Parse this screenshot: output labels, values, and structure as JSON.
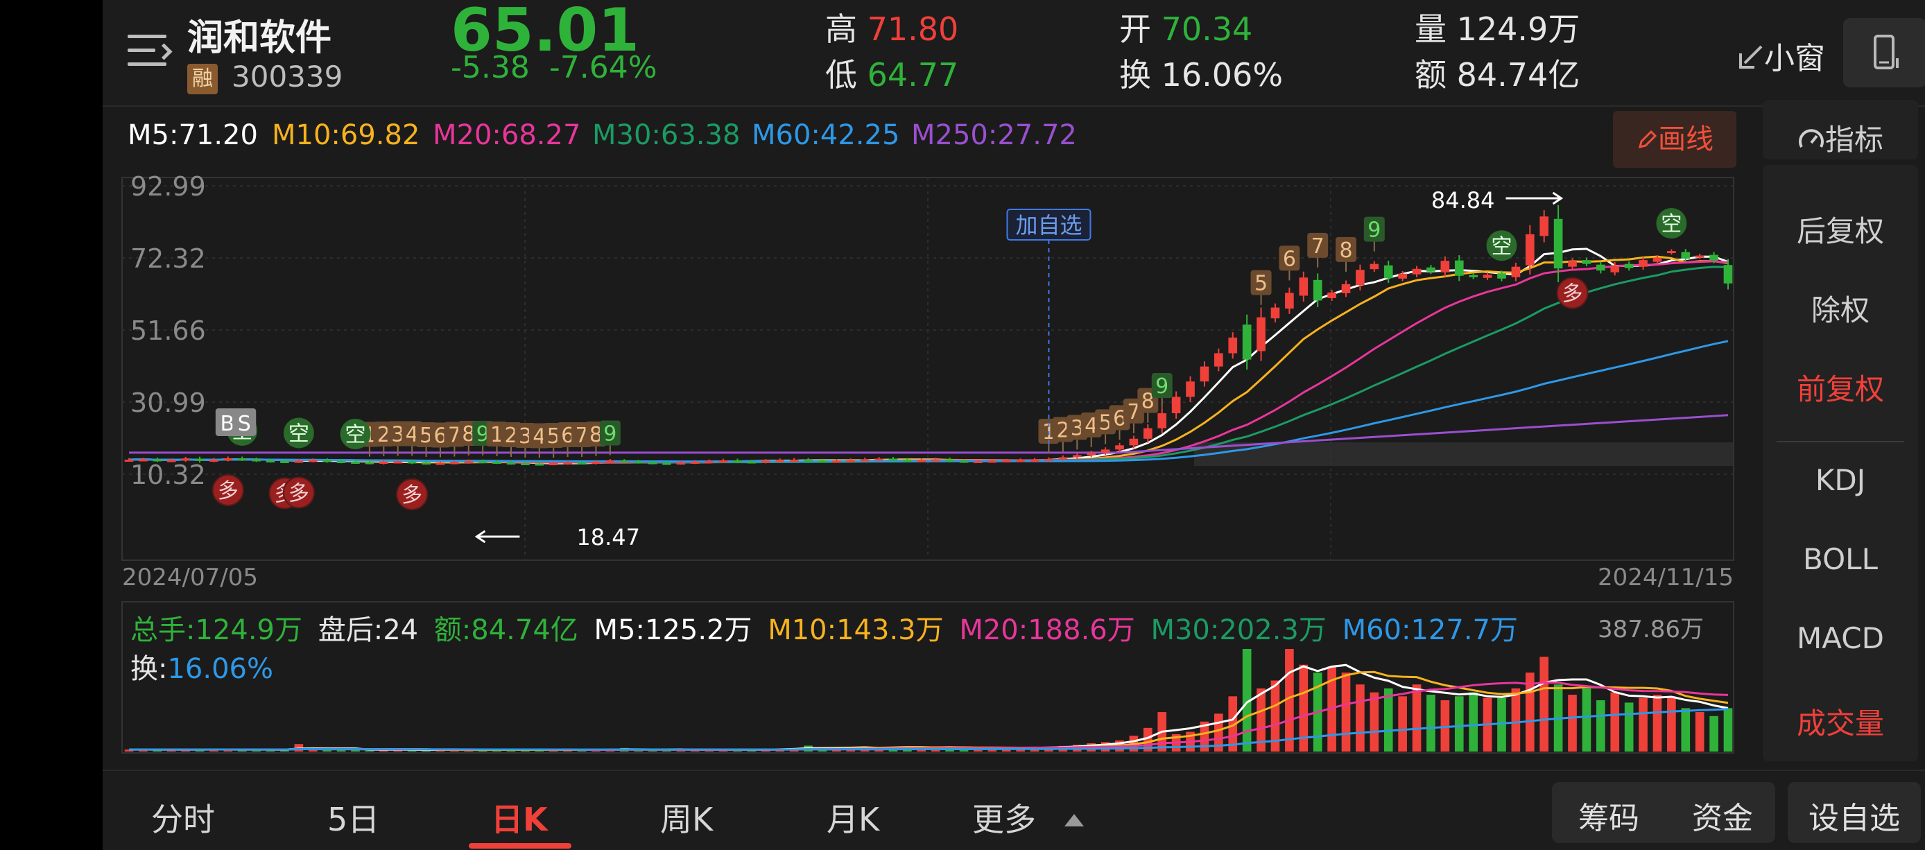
{
  "header": {
    "stock_name": "润和软件",
    "margin_badge": "融",
    "code": "300339",
    "price": "65.01",
    "change": "-5.38",
    "change_pct": "-7.64%",
    "high_label": "高",
    "high": "71.80",
    "low_label": "低",
    "low": "64.77",
    "open_label": "开",
    "open": "70.34",
    "turnover_label": "换",
    "turnover": "16.06%",
    "volume_label": "量",
    "volume": "124.9万",
    "amount_label": "额",
    "amount": "84.74亿",
    "float_window": "小窗"
  },
  "ma": {
    "m5": "M5:71.20",
    "m10": "M10:69.82",
    "m20": "M20:68.27",
    "m30": "M30:63.38",
    "m60": "M60:42.25",
    "m250": "M250:27.72"
  },
  "draw_line": "画线",
  "indicator_label": "指标",
  "sidebar": {
    "items": [
      "后复权",
      "除权",
      "前复权",
      "KDJ",
      "BOLL",
      "MACD",
      "成交量"
    ]
  },
  "colors": {
    "up": "#f0403a",
    "down": "#2fb23a",
    "m5": "#ffffff",
    "m10": "#f7b21e",
    "m20": "#e8369b",
    "m30": "#1b9b63",
    "m60": "#2e98e8",
    "m250": "#9a4fd0"
  },
  "chart_data": {
    "type": "candlestick",
    "y_ticks": [
      "92.99",
      "72.32",
      "51.66",
      "30.99",
      "10.32"
    ],
    "ylim": [
      10.32,
      92.99
    ],
    "x_start": "2024/07/05",
    "x_end": "2024/11/15",
    "annotations": {
      "high_mark": "84.84",
      "low_mark": "18.47",
      "watch_label": "加自选",
      "buy": "B",
      "sell": "S",
      "long": "多",
      "short": "空",
      "seq_a": [
        "1",
        "2",
        "3",
        "4",
        "5",
        "6",
        "7",
        "8",
        "9"
      ],
      "seq_b": [
        "1",
        "2",
        "3",
        "4",
        "5",
        "6",
        "7",
        "8",
        "9"
      ],
      "seq_c": [
        "1",
        "2",
        "3",
        "4",
        "5",
        "6",
        "7",
        "8"
      ],
      "seq_d": [
        "1",
        "2",
        "3",
        "4",
        "5",
        "6",
        "7",
        "8",
        "9"
      ],
      "seq_e": [
        "5",
        "6",
        "7",
        "8",
        "9"
      ]
    },
    "closes": [
      14.5,
      14.6,
      14.3,
      14.4,
      14.8,
      14.2,
      14.5,
      14.9,
      14.6,
      14.3,
      14.1,
      14.0,
      14.2,
      14.4,
      14.1,
      13.9,
      13.8,
      13.6,
      13.9,
      14.0,
      13.7,
      13.5,
      13.6,
      13.8,
      14.1,
      13.9,
      13.7,
      13.5,
      13.4,
      13.3,
      13.5,
      13.7,
      13.6,
      13.9,
      14.2,
      14.0,
      13.8,
      13.6,
      13.5,
      13.7,
      13.9,
      14.1,
      14.3,
      14.0,
      13.9,
      14.2,
      14.4,
      14.5,
      14.3,
      14.1,
      14.2,
      14.4,
      14.6,
      14.8,
      14.5,
      14.3,
      14.4,
      14.6,
      14.2,
      14.0,
      14.1,
      14.2,
      14.3,
      14.4,
      14.5,
      14.7,
      15.2,
      15.8,
      16.5,
      17.4,
      18.6,
      20.5,
      23.5,
      27.8,
      32.5,
      36.9,
      41.2,
      45.0,
      49.5,
      43.2,
      55.3,
      58.1,
      62.3,
      66.7,
      60.1,
      62.4,
      64.8,
      68.9,
      70.6,
      66.5,
      67.8,
      69.2,
      68.4,
      71.5,
      67.2,
      66.8,
      67.5,
      66.4,
      69.8,
      79.1,
      84.2,
      69.3,
      71.4,
      70.6,
      68.7,
      70.2,
      69.4,
      71.7,
      72.4,
      74.3,
      72.1,
      73.0,
      71.6,
      65.0
    ],
    "opens": [
      14.4,
      14.5,
      14.6,
      14.3,
      14.4,
      14.8,
      14.2,
      14.5,
      14.9,
      14.6,
      14.3,
      14.1,
      14.0,
      14.2,
      14.4,
      14.1,
      13.9,
      13.8,
      13.6,
      13.9,
      14.0,
      13.7,
      13.5,
      13.6,
      13.8,
      14.1,
      13.9,
      13.7,
      13.5,
      13.4,
      13.3,
      13.5,
      13.7,
      13.6,
      13.9,
      14.2,
      14.0,
      13.8,
      13.6,
      13.5,
      13.7,
      13.9,
      14.1,
      14.3,
      14.0,
      13.9,
      14.2,
      14.4,
      14.5,
      14.3,
      14.1,
      14.2,
      14.4,
      14.6,
      14.8,
      14.5,
      14.3,
      14.4,
      14.6,
      14.2,
      14.0,
      14.1,
      14.2,
      14.3,
      14.4,
      14.5,
      14.7,
      15.2,
      15.8,
      16.5,
      17.4,
      18.6,
      20.5,
      23.5,
      27.8,
      32.5,
      36.9,
      41.2,
      45.0,
      53.2,
      45.6,
      55.0,
      57.8,
      61.5,
      66.0,
      60.8,
      62.2,
      64.5,
      69.1,
      70.2,
      66.4,
      67.6,
      69.6,
      68.2,
      71.6,
      67.4,
      66.6,
      67.9,
      66.8,
      70.2,
      78.6,
      83.5,
      69.8,
      71.7,
      70.4,
      68.2,
      70.6,
      69.8,
      71.2,
      73.8,
      74.0,
      72.5,
      73.2,
      70.3
    ],
    "volumes": [
      2.5,
      2.8,
      2.2,
      2.6,
      2.4,
      2.9,
      3.2,
      2.3,
      2.1,
      2.5,
      2.8,
      2.0,
      9.5,
      2.7,
      2.2,
      2.6,
      2.4,
      2.1,
      2.3,
      2.5,
      2.0,
      1.8,
      2.2,
      2.4,
      2.1,
      1.9,
      2.3,
      2.6,
      2.0,
      2.2,
      1.8,
      2.5,
      2.7,
      2.1,
      2.3,
      4.5,
      2.2,
      2.0,
      2.4,
      2.6,
      2.3,
      2.1,
      1.9,
      2.5,
      2.7,
      3.0,
      3.5,
      4.2,
      7.5,
      3.2,
      4.0,
      5.5,
      6.0,
      4.5,
      5.2,
      6.5,
      5.0,
      4.8,
      5.5,
      4.2,
      3.8,
      4.5,
      5.0,
      4.2,
      5.5,
      6.0,
      7.2,
      8.5,
      10.5,
      12.0,
      14.0,
      20.0,
      30.0,
      50.0,
      22.0,
      25.0,
      38.0,
      48.0,
      70.0,
      130.0,
      80.0,
      90.0,
      130.0,
      110.0,
      100.0,
      108.0,
      100.0,
      85.0,
      75.0,
      80.0,
      70.0,
      85.0,
      72.0,
      65.0,
      70.0,
      75.0,
      68.0,
      68.0,
      80.0,
      100.0,
      120.0,
      85.0,
      72.0,
      80.0,
      65.0,
      75.0,
      62.0,
      68.0,
      72.0,
      70.0,
      55.0,
      50.0,
      45.0,
      55.0
    ],
    "volume_info": {
      "total": "总手:124.9万",
      "after_hours": "盘后:24",
      "amount": "额:84.74亿",
      "m5": "M5:125.2万",
      "m10": "M10:143.3万",
      "m20": "M20:188.6万",
      "m30": "M30:202.3万",
      "m60": "M60:127.7万",
      "max": "387.86万",
      "turnover_label": "换:",
      "turnover": "16.06%"
    }
  },
  "bottom_tabs": [
    "分时",
    "5日",
    "日K",
    "周K",
    "月K",
    "更多"
  ],
  "bottom_buttons": [
    "筹码",
    "资金",
    "设自选"
  ]
}
